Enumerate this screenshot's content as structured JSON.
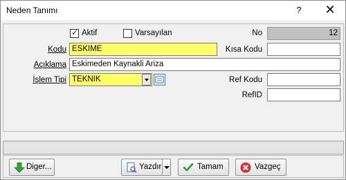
{
  "window": {
    "title": "Neden Tanımı",
    "help": "?",
    "close": "✕"
  },
  "form": {
    "aktif": {
      "label": "Aktif",
      "checked": true
    },
    "varsayilan": {
      "label": "Varsayılan",
      "checked": false
    },
    "no": {
      "label": "No",
      "value": "12"
    },
    "kodu": {
      "label": "Kodu",
      "value": "ESKIME"
    },
    "kisa_kodu": {
      "label": "Kısa Kodu",
      "value": ""
    },
    "aciklama": {
      "label": "Açıklama",
      "value": "Eskimeden Kaynakli Ariza"
    },
    "islem_tipi": {
      "label": "İşlem Tipi",
      "value": "TEKNIK"
    },
    "ref_kodu": {
      "label": "Ref Kodu",
      "value": ""
    },
    "ref_id": {
      "label": "RefID",
      "value": ""
    }
  },
  "status": {
    "text": ""
  },
  "buttons": {
    "diger": "Diger...",
    "yazdir": "Yazdır",
    "tamam": "Tamam",
    "vazgec": "Vazgeç"
  },
  "colors": {
    "required_field": "#ffff66",
    "readonly_field": "#c0c0c0"
  }
}
